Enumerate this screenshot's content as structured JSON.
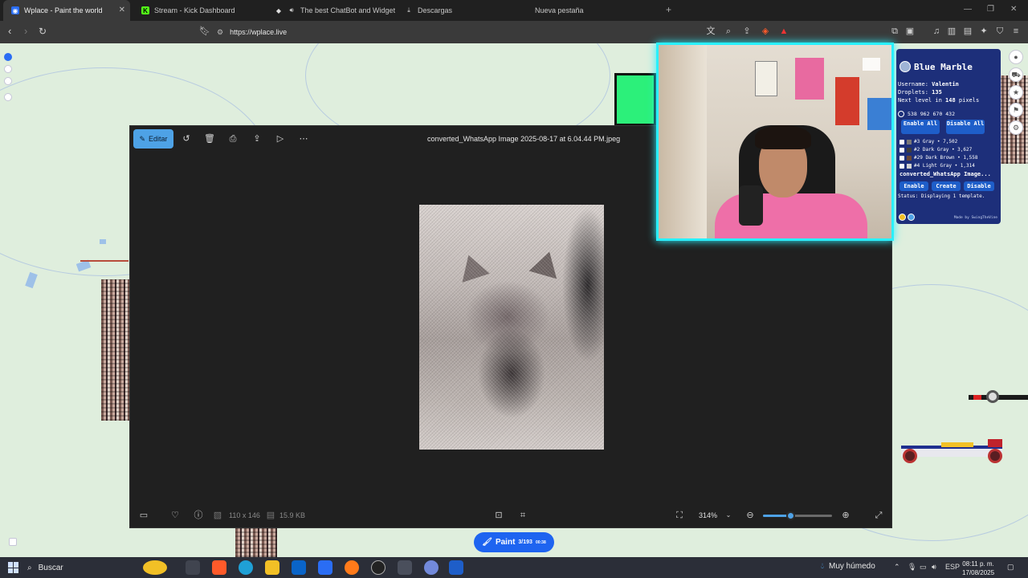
{
  "browser": {
    "tabs": [
      {
        "title": "Wplace - Paint the world",
        "active": true
      },
      {
        "title": "Stream - Kick Dashboard",
        "active": false
      },
      {
        "title": "The best ChatBot and Widgets fo",
        "active": false
      },
      {
        "title": "Descargas",
        "active": false
      },
      {
        "title": "Nueva pestaña",
        "active": false
      }
    ],
    "url": "https://wplace.live"
  },
  "viewer": {
    "edit_label": "Editar",
    "file_title": "converted_WhatsApp Image 2025-08-17 at 6.04.44 PM.jpeg",
    "dimensions": "110 x 146",
    "file_size": "15.9 KB",
    "zoom": "314%",
    "zoom_slider_fraction": 0.4
  },
  "blue_marble": {
    "title": "Blue Marble",
    "username_label": "Username:",
    "username": "Valentin",
    "droplets_label": "Droplets:",
    "droplets": "135",
    "next_level_prefix": "Next level in",
    "next_level_value": "148",
    "next_level_suffix": "pixels",
    "coords": [
      "538",
      "962",
      "670",
      "432"
    ],
    "enable_all": "Enable All",
    "disable_all": "Disable All",
    "colors": [
      {
        "label": "#3 Gray • 7,502",
        "swatch": "#787878"
      },
      {
        "label": "#2 Dark Gray • 3,627",
        "swatch": "#3c3c3c"
      },
      {
        "label": "#29 Dark Brown • 1,558",
        "swatch": "#684634"
      },
      {
        "label": "#4 Light Gray • 1,314",
        "swatch": "#d2d2d2"
      }
    ],
    "template_name": "converted_WhatsApp Image...",
    "enable": "Enable",
    "create": "Create",
    "disable": "Disable",
    "status": "Status: Displaying 1 template.",
    "credit": "Made by SwingTheVine"
  },
  "paint_button": {
    "label": "Paint",
    "count": "3/193",
    "timer": "00:38"
  },
  "taskbar": {
    "search": "Buscar",
    "weather": "Muy húmedo",
    "lang": "ESP",
    "time": "08:11 p. m.",
    "date": "17/08/2025"
  },
  "colors": {
    "accent": "#4ea2e6",
    "paint_button": "#1e64f0",
    "blue_marble_bg": "#1d2f7a",
    "cam_border": "#29f0ff"
  }
}
